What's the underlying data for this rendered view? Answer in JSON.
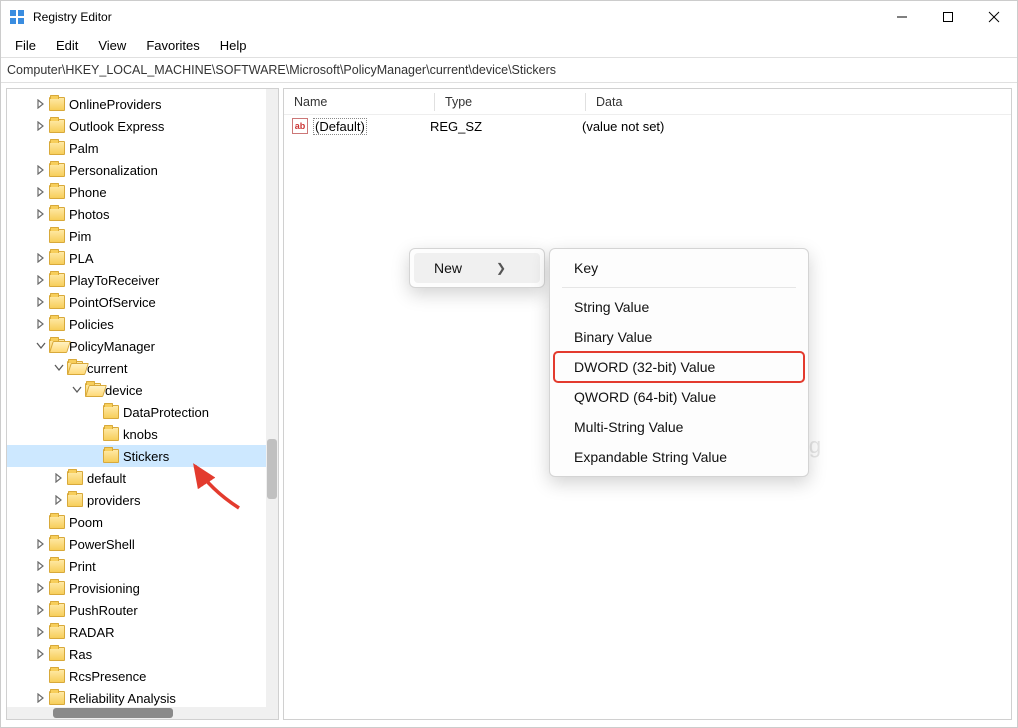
{
  "window": {
    "title": "Registry Editor"
  },
  "menu": {
    "file": "File",
    "edit": "Edit",
    "view": "View",
    "favorites": "Favorites",
    "help": "Help"
  },
  "addressbar": {
    "path": "Computer\\HKEY_LOCAL_MACHINE\\SOFTWARE\\Microsoft\\PolicyManager\\current\\device\\Stickers"
  },
  "tree": {
    "items": [
      {
        "indent": 1,
        "expand": ">",
        "open": false,
        "label": "OnlineProviders"
      },
      {
        "indent": 1,
        "expand": ">",
        "open": false,
        "label": "Outlook Express"
      },
      {
        "indent": 1,
        "expand": "",
        "open": false,
        "label": "Palm"
      },
      {
        "indent": 1,
        "expand": ">",
        "open": false,
        "label": "Personalization"
      },
      {
        "indent": 1,
        "expand": ">",
        "open": false,
        "label": "Phone"
      },
      {
        "indent": 1,
        "expand": ">",
        "open": false,
        "label": "Photos"
      },
      {
        "indent": 1,
        "expand": "",
        "open": false,
        "label": "Pim"
      },
      {
        "indent": 1,
        "expand": ">",
        "open": false,
        "label": "PLA"
      },
      {
        "indent": 1,
        "expand": ">",
        "open": false,
        "label": "PlayToReceiver"
      },
      {
        "indent": 1,
        "expand": ">",
        "open": false,
        "label": "PointOfService"
      },
      {
        "indent": 1,
        "expand": ">",
        "open": false,
        "label": "Policies"
      },
      {
        "indent": 1,
        "expand": "v",
        "open": true,
        "label": "PolicyManager"
      },
      {
        "indent": 2,
        "expand": "v",
        "open": true,
        "label": "current"
      },
      {
        "indent": 3,
        "expand": "v",
        "open": true,
        "label": "device"
      },
      {
        "indent": 4,
        "expand": "",
        "open": false,
        "label": "DataProtection"
      },
      {
        "indent": 4,
        "expand": "",
        "open": false,
        "label": "knobs"
      },
      {
        "indent": 4,
        "expand": "",
        "open": false,
        "label": "Stickers",
        "selected": true
      },
      {
        "indent": 2,
        "expand": ">",
        "open": false,
        "label": "default"
      },
      {
        "indent": 2,
        "expand": ">",
        "open": false,
        "label": "providers"
      },
      {
        "indent": 1,
        "expand": "",
        "open": false,
        "label": "Poom"
      },
      {
        "indent": 1,
        "expand": ">",
        "open": false,
        "label": "PowerShell"
      },
      {
        "indent": 1,
        "expand": ">",
        "open": false,
        "label": "Print"
      },
      {
        "indent": 1,
        "expand": ">",
        "open": false,
        "label": "Provisioning"
      },
      {
        "indent": 1,
        "expand": ">",
        "open": false,
        "label": "PushRouter"
      },
      {
        "indent": 1,
        "expand": ">",
        "open": false,
        "label": "RADAR"
      },
      {
        "indent": 1,
        "expand": ">",
        "open": false,
        "label": "Ras"
      },
      {
        "indent": 1,
        "expand": "",
        "open": false,
        "label": "RcsPresence"
      },
      {
        "indent": 1,
        "expand": ">",
        "open": false,
        "label": "Reliability Analysis"
      }
    ]
  },
  "list": {
    "headers": {
      "name": "Name",
      "type": "Type",
      "data": "Data"
    },
    "rows": [
      {
        "icon": "ab",
        "name": "(Default)",
        "type": "REG_SZ",
        "data": "(value not set)"
      }
    ]
  },
  "context_primary": {
    "items": [
      {
        "label": "New",
        "submenu": true
      }
    ]
  },
  "context_new": {
    "items": [
      {
        "label": "Key",
        "sep_after": true
      },
      {
        "label": "String Value"
      },
      {
        "label": "Binary Value"
      },
      {
        "label": "DWORD (32-bit) Value",
        "highlighted": true
      },
      {
        "label": "QWORD (64-bit) Value"
      },
      {
        "label": "Multi-String Value"
      },
      {
        "label": "Expandable String Value"
      }
    ]
  },
  "watermark": {
    "text": "uantrimang"
  }
}
